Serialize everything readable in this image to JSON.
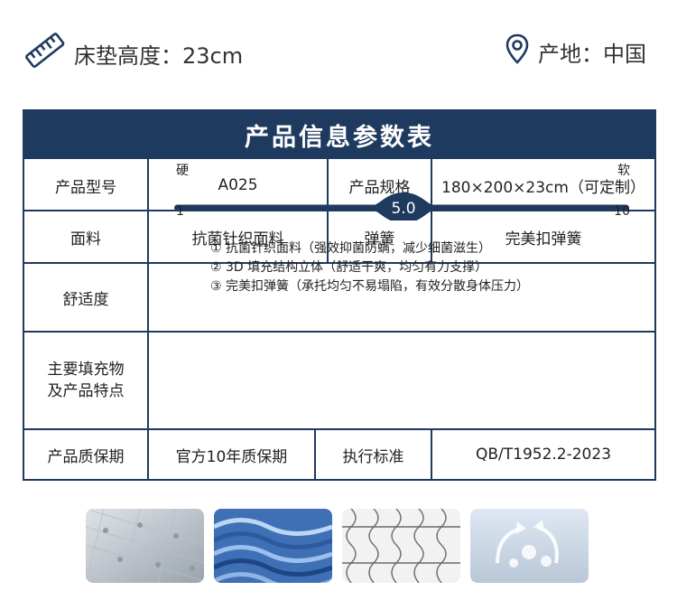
{
  "header": {
    "height_label": "床垫高度：23cm",
    "origin_label": "产地：中国",
    "height_icon": "ruler-icon",
    "origin_icon": "location-pin-icon"
  },
  "table": {
    "title": "产品信息参数表",
    "rows": {
      "model_label": "产品型号",
      "model_value": "A025",
      "size_label": "产品规格",
      "size_value": "180×200×23cm（可定制）",
      "fabric_label": "面料",
      "fabric_value": "抗菌针织面料",
      "spring_label": "弹簧",
      "spring_value": "完美扣弹簧",
      "comfort_label": "舒适度",
      "features_label_line1": "主要填充物",
      "features_label_line2": "及产品特点",
      "warranty_label": "产品质保期",
      "warranty_value": "官方10年质保期",
      "standard_label": "执行标准",
      "standard_value": "QB/T1952.2-2023"
    },
    "comfort": {
      "hard_label": "硬",
      "soft_label": "软",
      "min_label": "1",
      "max_label": "10",
      "value_label": "5.0",
      "value": 5.0,
      "min": 1,
      "max": 10
    },
    "features": [
      "① 抗菌针织面料（强效抑菌防螨，减少细菌滋生）",
      "② 3D 填充结构立体（舒适干爽，均匀有力支撑）",
      "③ 完美扣弹簧（承托均匀不易塌陷，有效分散身体压力）"
    ]
  },
  "colors": {
    "navy": "#1f3a5f",
    "text": "#222222"
  }
}
